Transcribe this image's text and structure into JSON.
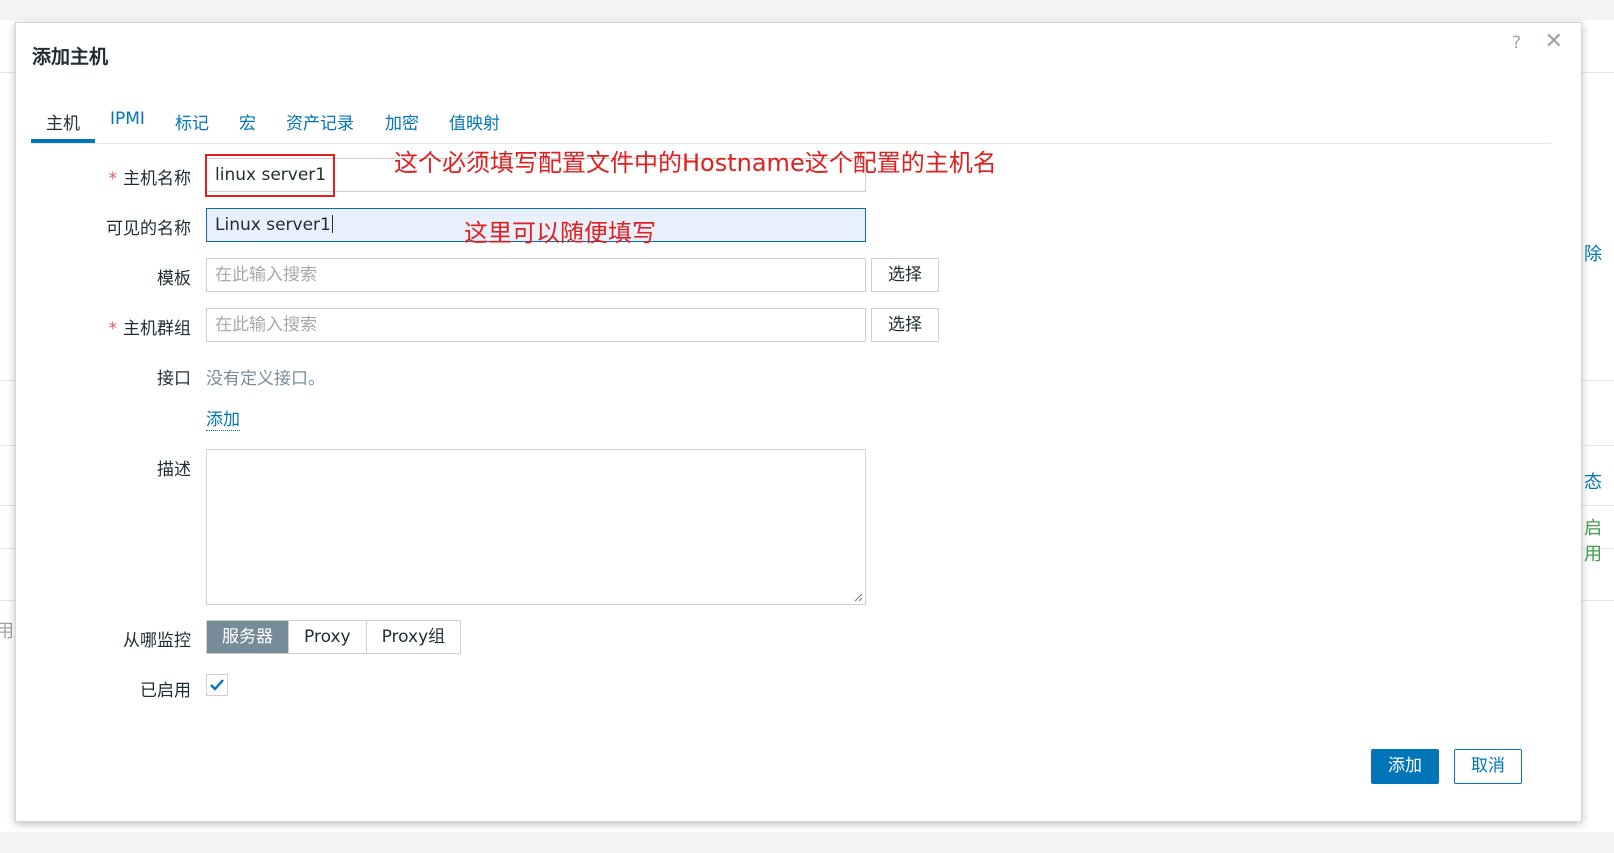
{
  "background": {
    "right_fragments": [
      "除",
      "态",
      "启用"
    ],
    "left_fragment": "用"
  },
  "dialog": {
    "title": "添加主机",
    "help_icon": "?",
    "close_icon": "✕",
    "tabs": [
      {
        "label": "主机",
        "active": true
      },
      {
        "label": "IPMI"
      },
      {
        "label": "标记"
      },
      {
        "label": "宏"
      },
      {
        "label": "资产记录"
      },
      {
        "label": "加密"
      },
      {
        "label": "值映射"
      }
    ],
    "form": {
      "host_name": {
        "label": "主机名称",
        "required": true,
        "value": "linux server1"
      },
      "visible_name": {
        "label": "可见的名称",
        "value": "Linux server1"
      },
      "templates": {
        "label": "模板",
        "placeholder": "在此输入搜索",
        "button": "选择"
      },
      "host_groups": {
        "label": "主机群组",
        "required": true,
        "placeholder": "在此输入搜索",
        "button": "选择"
      },
      "interfaces": {
        "label": "接口",
        "empty_text": "没有定义接口。",
        "add_link": "添加"
      },
      "description": {
        "label": "描述",
        "value": ""
      },
      "monitored_by": {
        "label": "从哪监控",
        "options": [
          "服务器",
          "Proxy",
          "Proxy组"
        ],
        "selected": "服务器"
      },
      "enabled": {
        "label": "已启用",
        "checked": true
      }
    },
    "buttons": {
      "add": "添加",
      "cancel": "取消"
    }
  },
  "annotations": {
    "host_name_note": "这个必须填写配置文件中的Hostname这个配置的主机名",
    "visible_name_note": "这里可以随便填写"
  },
  "colors": {
    "accent": "#0275b8",
    "annotation": "#e02020",
    "required": "#e45959",
    "segment_active": "#768d99"
  }
}
